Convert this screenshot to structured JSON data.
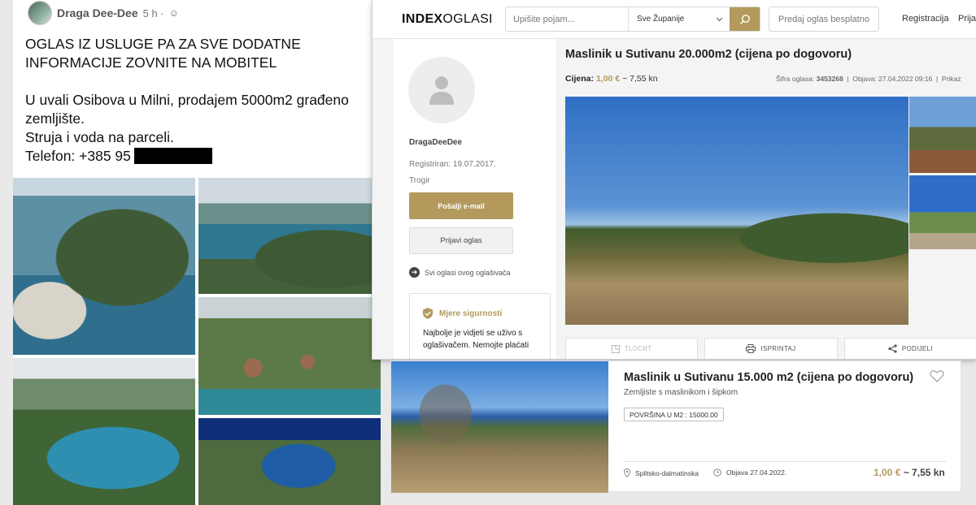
{
  "facebook": {
    "author": "Draga Dee-Dee",
    "time": "5 h",
    "post_lines": [
      "OGLAS IZ USLUGE PA ZA SVE DODATNE\nINFORMACIJE ZOVNITE NA MOBITEL",
      "U uvali Osibova u Milni, prodajem 5000m2 građeno\nzemljište.\nStruja i voda na parceli."
    ],
    "phone_prefix": "Telefon: +385 95",
    "photos_icon": "photo-grid"
  },
  "index": {
    "logo_bold": "INDEX",
    "logo_rest": "OGLASI",
    "search_placeholder": "Upišite pojam...",
    "county_select": "Sve Županije",
    "sell_button": "Predaj oglas besplatno",
    "register_link": "Registracija",
    "login_link": "Prijav",
    "seller": {
      "name": "DragaDeeDee",
      "registered": "Registriran: 19.07.2017.",
      "city": "Trogir",
      "email_button": "Pošalji e-mail",
      "report_button": "Prijavi oglas",
      "all_ads_link": "Svi oglasi ovog oglašivača"
    },
    "safety": {
      "title": "Mjere sigurnosti",
      "text": "Najbolje je vidjeti se uživo s oglašivačem. Nemojte plaćati"
    },
    "ad": {
      "title": "Maslinik u Sutivanu 20.000m2 (cijena po dogovoru)",
      "price_label": "Cijena:",
      "price_eur": "1,00 €",
      "price_kn": "~ 7,55 kn",
      "ad_code_label": "Šifra oglasa:",
      "ad_code": "3453268",
      "published": "Objava: 27.04.2022 09:16",
      "views_label": "Prikaz"
    },
    "actions": {
      "floorplan": "TLOCRT",
      "print": "ISPRINTAJ",
      "share": "PODIJELI"
    },
    "colors": {
      "accent": "#b39a5c"
    }
  },
  "listing_card": {
    "title": "Maslinik u Sutivanu 15.000 m2 (cijena po dogovoru)",
    "subtitle": "Zemljiste s maslinikom i šipkom",
    "area_tag": "POVRŠINA U M2 : 15000.00",
    "location": "Splitsko-dalmatinska",
    "published": "Objava 27.04.2022.",
    "price_eur": "1,00 €",
    "price_kn": "~ 7,55 kn"
  }
}
